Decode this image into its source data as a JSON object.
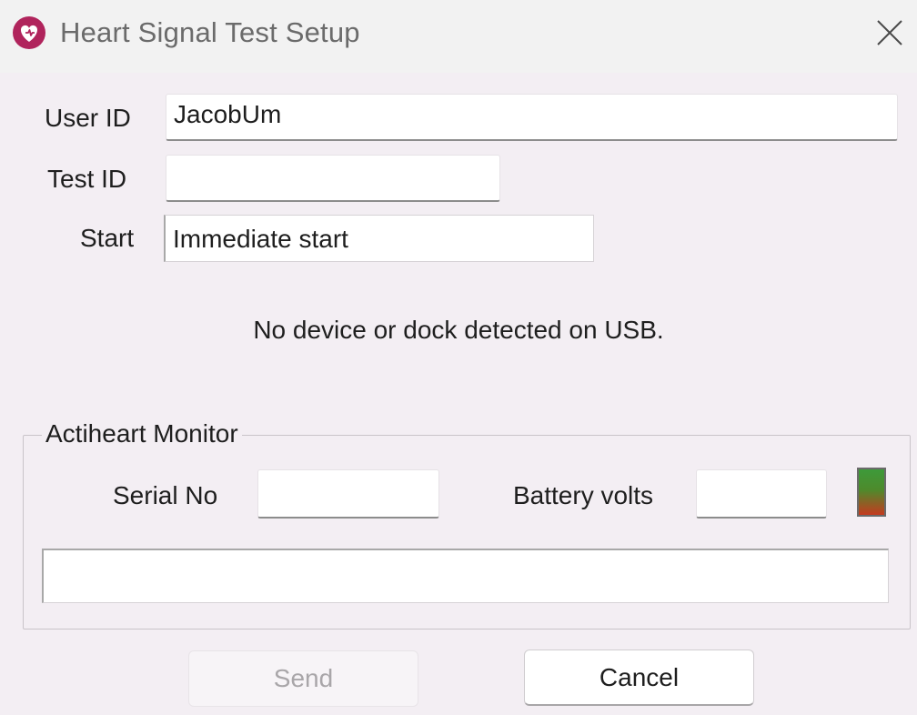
{
  "window": {
    "title": "Heart Signal Test Setup",
    "icon": "heart-app-icon",
    "close_icon": "close-icon"
  },
  "form": {
    "user_id_label": "User ID",
    "user_id_value": "JacobUm",
    "test_id_label": "Test ID",
    "test_id_value": "",
    "start_label": "Start",
    "start_value": "Immediate start"
  },
  "status": {
    "message": "No device or dock detected on USB."
  },
  "monitor": {
    "group_title": "Actiheart Monitor",
    "serial_label": "Serial No",
    "serial_value": "",
    "battery_label": "Battery volts",
    "battery_value": "",
    "battery_indicator_colors": [
      "#3d9a3a",
      "#c43a1f"
    ],
    "message_value": ""
  },
  "buttons": {
    "send_label": "Send",
    "cancel_label": "Cancel"
  },
  "colors": {
    "app_icon": "#b0245c",
    "background": "#f3eef3"
  }
}
